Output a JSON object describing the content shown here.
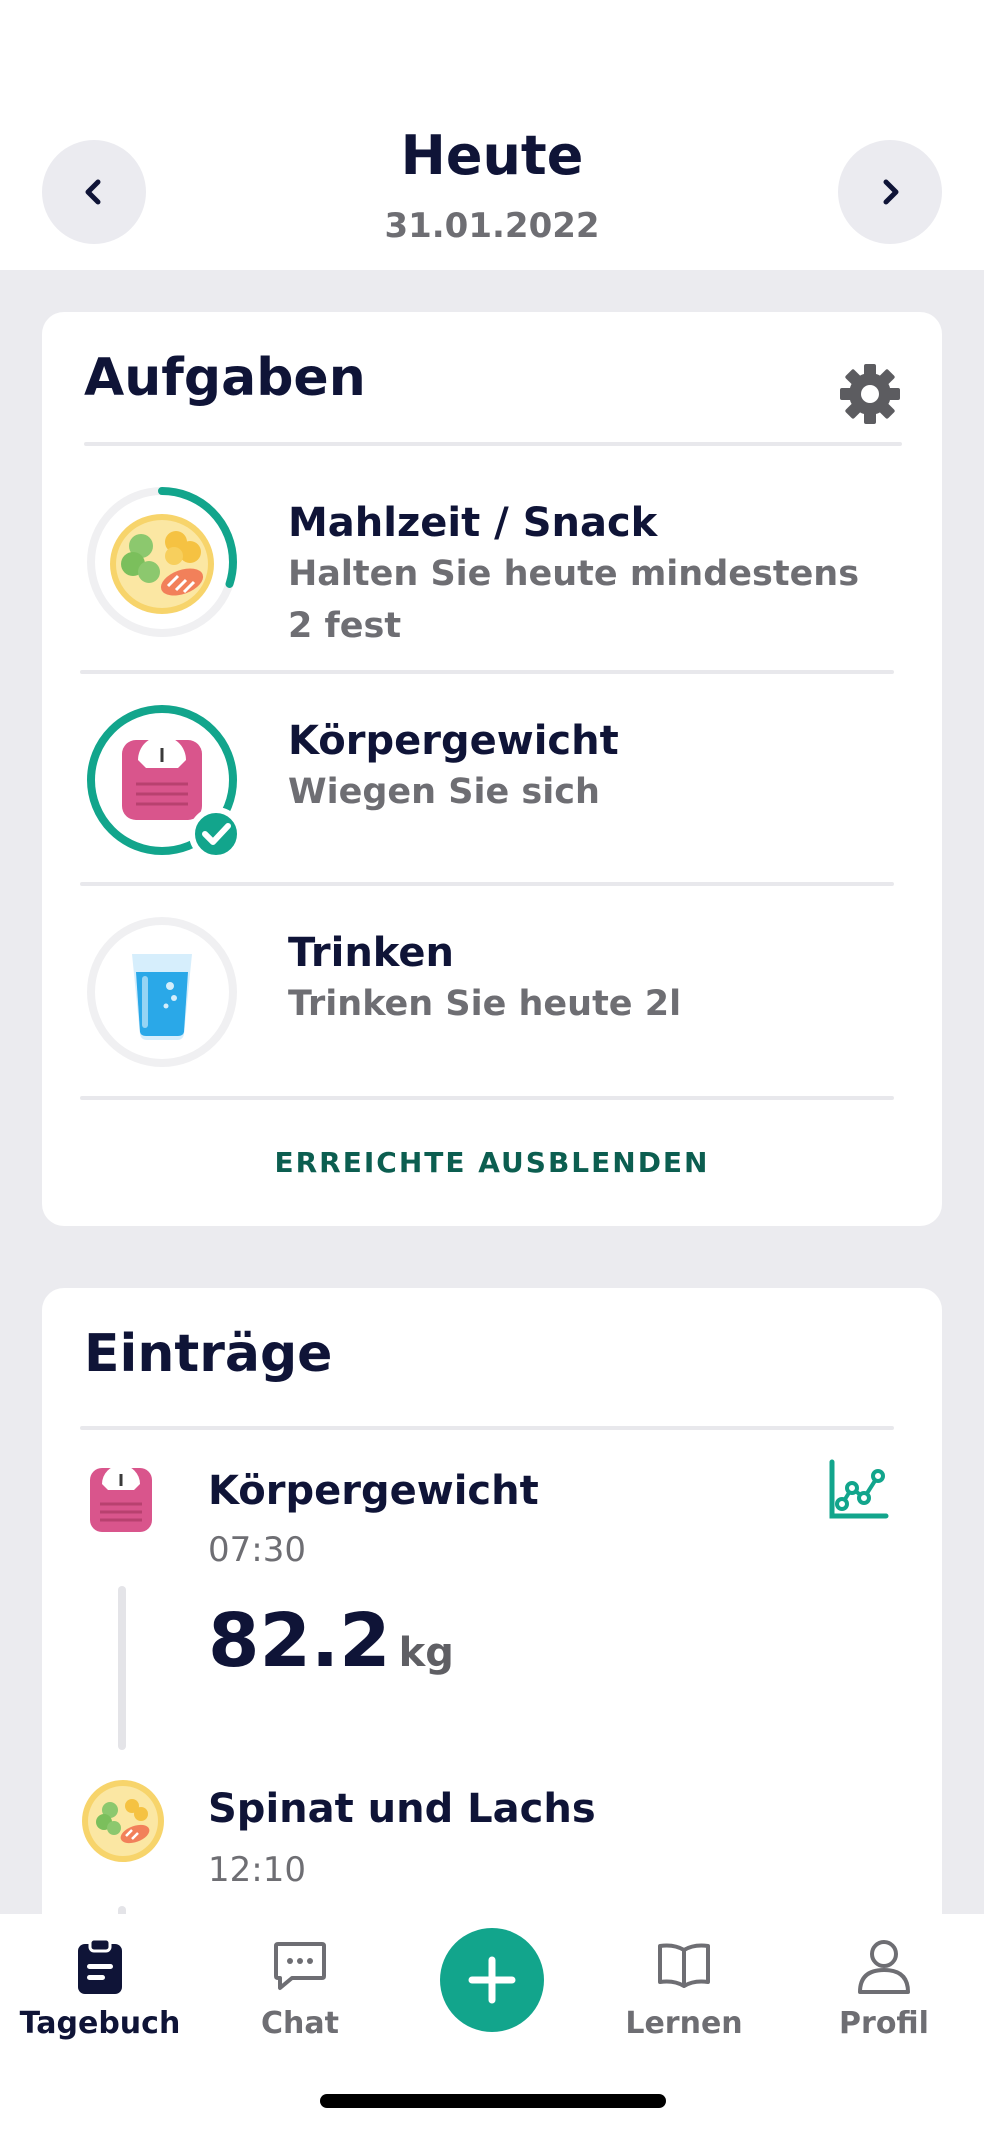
{
  "header": {
    "title": "Heute",
    "date": "31.01.2022",
    "prev_icon": "chevron-left-icon",
    "next_icon": "chevron-right-icon"
  },
  "tasks": {
    "title": "Aufgaben",
    "settings_icon": "gear-icon",
    "items": [
      {
        "title": "Mahlzeit / Snack",
        "subtitle": "Halten Sie heute mindestens 2 fest",
        "icon": "meal-plate-icon",
        "progress": 0.3,
        "done": false
      },
      {
        "title": "Körpergewicht",
        "subtitle": "Wiegen Sie sich",
        "icon": "scale-icon",
        "progress": 1.0,
        "done": true
      },
      {
        "title": "Trinken",
        "subtitle": "Trinken Sie heute 2l",
        "icon": "water-glass-icon",
        "progress": 0,
        "done": false
      }
    ],
    "hide_label": "ERREICHTE AUSBLENDEN"
  },
  "entries": {
    "title": "Einträge",
    "items": [
      {
        "title": "Körpergewicht",
        "time": "07:30",
        "value": "82.2",
        "unit": "kg",
        "icon": "scale-icon"
      },
      {
        "title": "Spinat und Lachs",
        "time": "12:10",
        "icon": "meal-plate-icon"
      }
    ],
    "chart_icon": "line-chart-icon"
  },
  "tabbar": {
    "tabs": [
      {
        "label": "Tagebuch",
        "icon": "clipboard-icon",
        "active": true
      },
      {
        "label": "Chat",
        "icon": "chat-icon",
        "active": false
      },
      {
        "label": "Lernen",
        "icon": "book-icon",
        "active": false
      },
      {
        "label": "Profil",
        "icon": "person-icon",
        "active": false
      }
    ],
    "add_icon": "plus-icon"
  },
  "colors": {
    "accent": "#12a58c",
    "link": "#0c5e50",
    "text_primary": "#0f1437",
    "text_secondary": "#6e6e73",
    "background": "#ebebef"
  }
}
